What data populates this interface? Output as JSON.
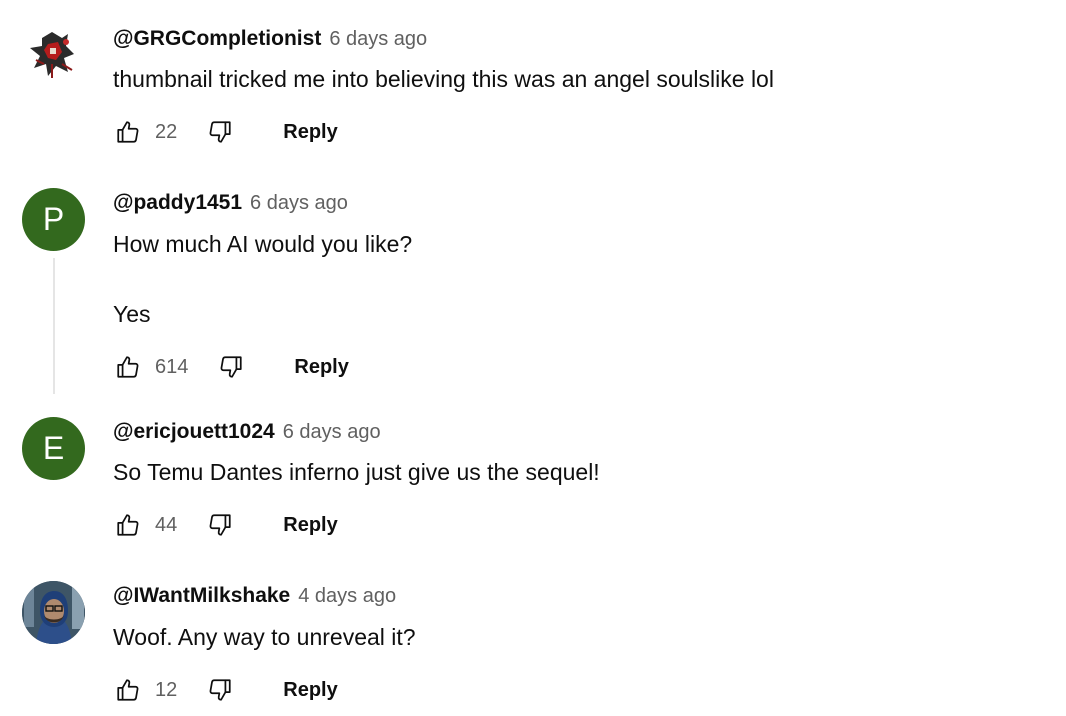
{
  "comments": [
    {
      "author": "@GRGCompletionist",
      "time": "6 days ago",
      "text": "thumbnail tricked me into believing this was an angel soulslike lol",
      "likes": "22",
      "reply_label": "Reply",
      "avatar_icon": "artwork-avatar"
    },
    {
      "author": "@paddy1451",
      "time": "6 days ago",
      "text": "How much AI would you like?\n\nYes",
      "likes": "614",
      "reply_label": "Reply",
      "avatar_letter": "P",
      "avatar_color": "#33691e"
    },
    {
      "author": "@ericjouett1024",
      "time": "6 days ago",
      "text": "So Temu Dantes inferno just give us the sequel!",
      "likes": "44",
      "reply_label": "Reply",
      "avatar_letter": "E",
      "avatar_color": "#33691e"
    },
    {
      "author": "@IWantMilkshake",
      "time": "4 days ago",
      "text": "Woof. Any way to unreveal it?",
      "likes": "12",
      "reply_label": "Reply",
      "avatar_icon": "photo-avatar"
    }
  ]
}
